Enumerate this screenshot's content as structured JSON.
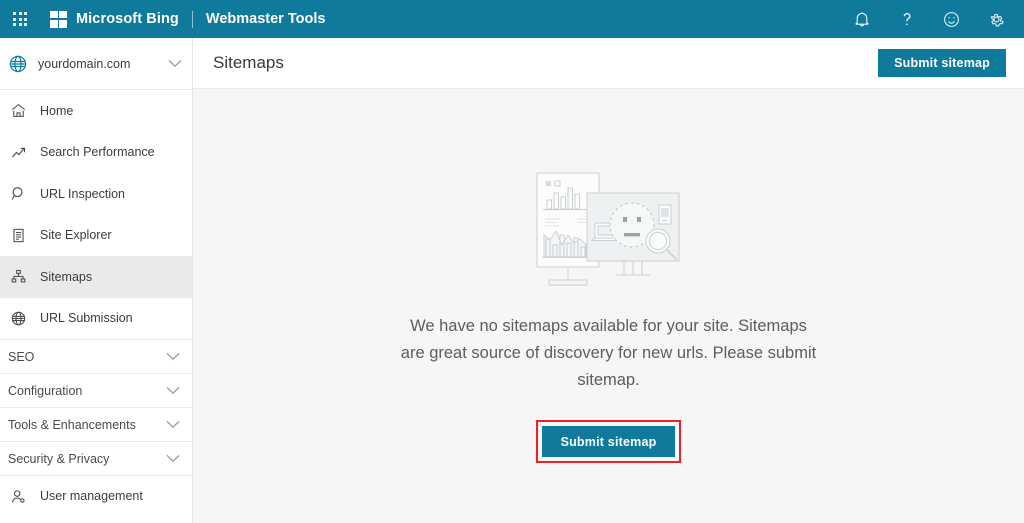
{
  "colors": {
    "brand_teal": "#0f7A9C",
    "annotation_red": "#ee1f25",
    "sidebar_active": "#eaeaea",
    "content_bg": "#f6f6f6",
    "text_primary": "#3a3a3a",
    "text_secondary": "#5d5d5d",
    "illustration_stroke": "#c9cfd2"
  },
  "topbar": {
    "waffle_icon": "app-launcher-waffle-icon",
    "logo_icon": "microsoft-logo-icon",
    "brand": "Microsoft Bing",
    "subbrand": "Webmaster Tools",
    "icons": [
      {
        "name": "notifications-bell-icon",
        "glyph": "bell"
      },
      {
        "name": "help-question-icon",
        "glyph": "question"
      },
      {
        "name": "feedback-smiley-icon",
        "glyph": "smiley"
      },
      {
        "name": "settings-gear-icon",
        "glyph": "gear"
      }
    ]
  },
  "sidebar": {
    "site_picker": {
      "icon": "globe-icon",
      "site": "yourdomain.com",
      "chevron": "chevron-down-icon"
    },
    "items": [
      {
        "label": "Home",
        "icon": "home-icon",
        "type": "link",
        "active": false
      },
      {
        "label": "Search Performance",
        "icon": "trending-up-icon",
        "type": "link",
        "active": false
      },
      {
        "label": "URL Inspection",
        "icon": "magnifier-icon",
        "type": "link",
        "active": false
      },
      {
        "label": "Site Explorer",
        "icon": "document-list-icon",
        "type": "link",
        "active": false
      },
      {
        "label": "Sitemaps",
        "icon": "sitemap-hierarchy-icon",
        "type": "link",
        "active": true
      },
      {
        "label": "URL Submission",
        "icon": "globe-grid-icon",
        "type": "link",
        "active": false
      },
      {
        "label": "SEO",
        "icon": "chevron-down-icon",
        "type": "group",
        "active": false
      },
      {
        "label": "Configuration",
        "icon": "chevron-down-icon",
        "type": "group",
        "active": false
      },
      {
        "label": "Tools & Enhancements",
        "icon": "chevron-down-icon",
        "type": "group",
        "active": false
      },
      {
        "label": "Security & Privacy",
        "icon": "chevron-down-icon",
        "type": "group",
        "active": false
      },
      {
        "label": "User management",
        "icon": "user-person-icon",
        "type": "link",
        "active": false
      }
    ]
  },
  "page": {
    "title": "Sitemaps",
    "header_button": "Submit sitemap",
    "empty_state": {
      "illustration": "no-data-dashboard-illustration",
      "message": "We have no sitemaps available for your site. Sitemaps are great source of discovery for new urls. Please submit sitemap.",
      "cta_label": "Submit sitemap",
      "cta_annotated": true
    }
  }
}
